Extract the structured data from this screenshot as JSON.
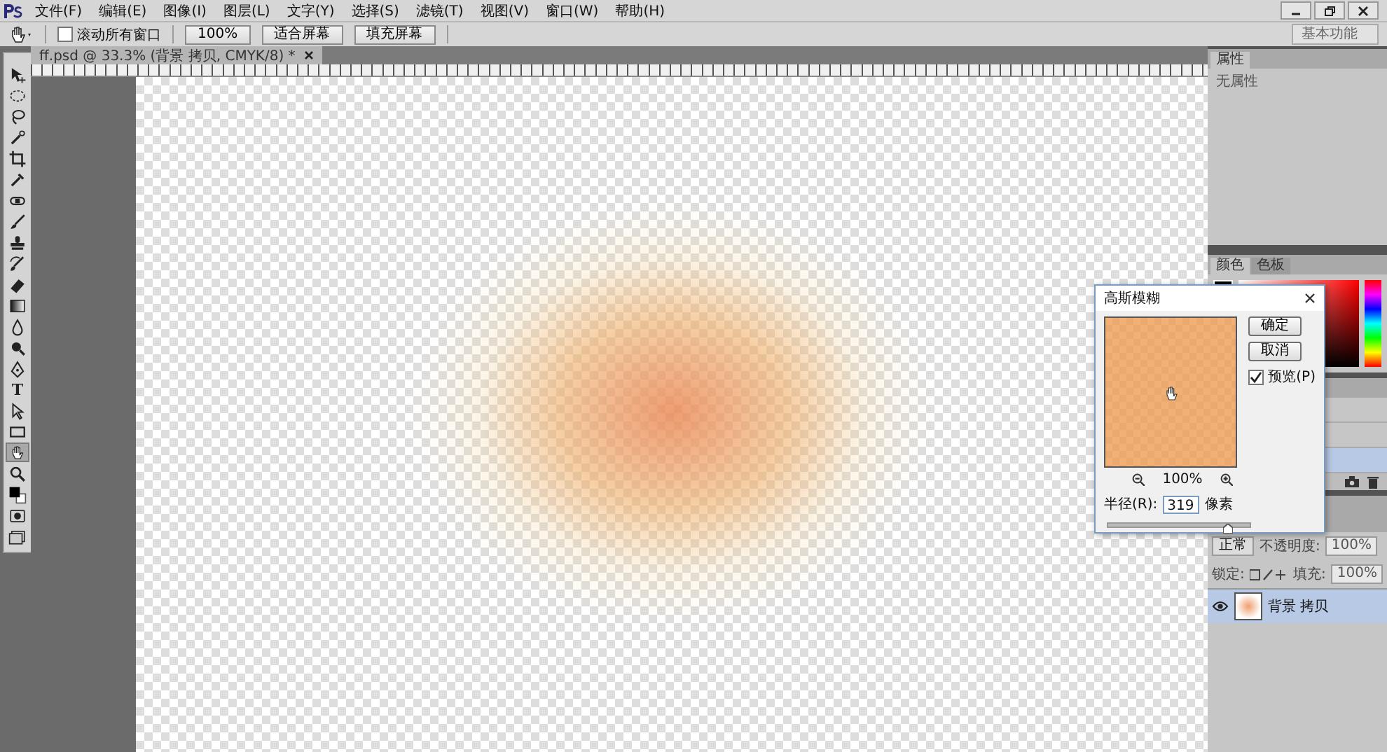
{
  "menu": [
    "文件(F)",
    "编辑(E)",
    "图像(I)",
    "图层(L)",
    "文字(Y)",
    "选择(S)",
    "滤镜(T)",
    "视图(V)",
    "窗口(W)",
    "帮助(H)"
  ],
  "workspace": "基本功能",
  "options_bar": {
    "scroll_all": {
      "label": "滚动所有窗口",
      "checked": false
    },
    "buttons": [
      "100%",
      "适合屏幕",
      "填充屏幕"
    ]
  },
  "document_tab": {
    "title": "ff.psd @ 33.3% (背景 拷贝, CMYK/8) *"
  },
  "tools": [
    {
      "kind": "move",
      "selected": false
    },
    {
      "kind": "marquee",
      "selected": false
    },
    {
      "kind": "lasso",
      "selected": false
    },
    {
      "kind": "wand",
      "selected": false
    },
    {
      "kind": "crop",
      "selected": false
    },
    {
      "kind": "eyedropper",
      "selected": false
    },
    {
      "kind": "heal",
      "selected": false
    },
    {
      "kind": "brush",
      "selected": false
    },
    {
      "kind": "stamp",
      "selected": false
    },
    {
      "kind": "history",
      "selected": false
    },
    {
      "kind": "eraser",
      "selected": false
    },
    {
      "kind": "gradient",
      "selected": false
    },
    {
      "kind": "blur",
      "selected": false
    },
    {
      "kind": "dodge",
      "selected": false
    },
    {
      "kind": "pen",
      "selected": false
    },
    {
      "kind": "type",
      "label": "T",
      "selected": false
    },
    {
      "kind": "path",
      "selected": false
    },
    {
      "kind": "shape",
      "selected": false
    },
    {
      "kind": "hand",
      "selected": true
    },
    {
      "kind": "zoom",
      "selected": false
    },
    {
      "kind": "swatches",
      "selected": false
    },
    {
      "kind": "mask",
      "selected": false
    },
    {
      "kind": "screen",
      "selected": false
    }
  ],
  "properties_panel": {
    "tabs": [
      {
        "label": "属性",
        "selected": true
      }
    ],
    "message": "无属性"
  },
  "list_panel": {
    "rows": [
      {
        "selected": false
      },
      {
        "selected": false
      },
      {
        "selected": true
      }
    ]
  },
  "color_panel": {
    "tabs": [
      {
        "label": "颜色",
        "selected": true
      },
      {
        "label": "色板",
        "selected": false
      }
    ]
  },
  "layers_panel": {
    "blend_mode": "正常",
    "opacity_label": "不透明度:",
    "opacity": "100%",
    "lock_label": "锁定:",
    "fill_label": "填充:",
    "fill": "100%",
    "layers": [
      {
        "name": "背景 拷贝",
        "visible": true,
        "selected": true
      }
    ]
  },
  "dialog": {
    "title": "高斯模糊",
    "buttons": [
      "确定",
      "取消"
    ],
    "preview": {
      "label": "预览(P)",
      "checked": true
    },
    "zoom": "100%",
    "radius_label": "半径(R):",
    "radius": "319",
    "unit": "像素",
    "slider": {
      "level": 0.85
    }
  }
}
